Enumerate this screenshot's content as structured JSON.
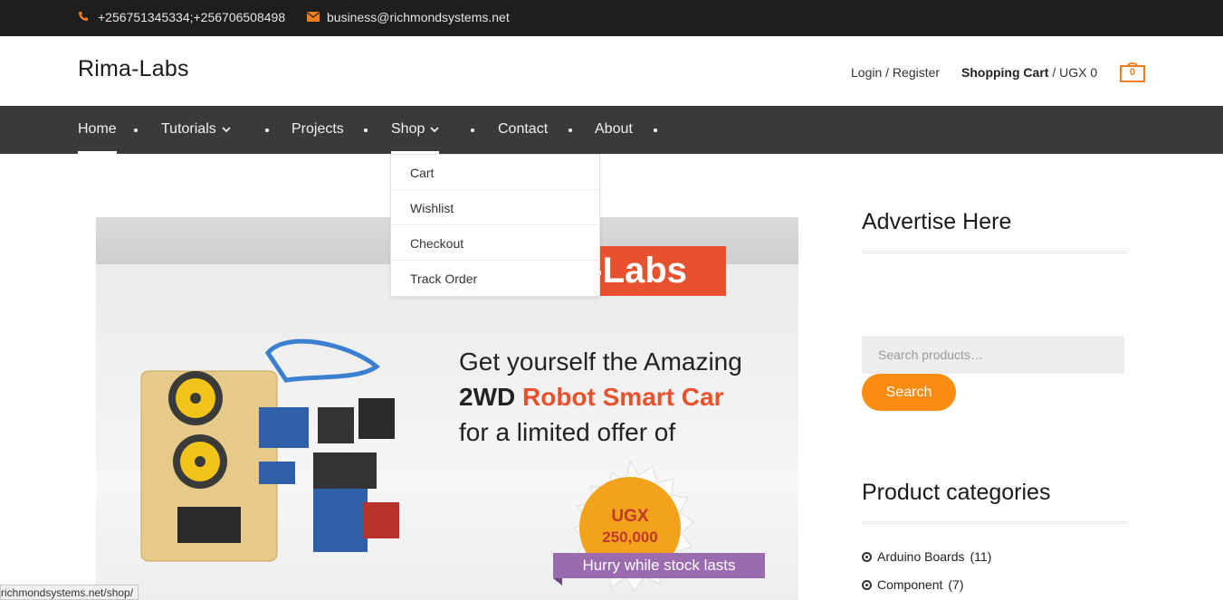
{
  "topbar": {
    "phone": "+256751345334;+256706508498",
    "email": "business@richmondsystems.net",
    "phone_icon": "phone-icon",
    "email_icon": "envelope-icon"
  },
  "header": {
    "logo": "Rima-Labs",
    "login": "Login / Register",
    "cart_label": "Shopping Cart",
    "cart_amount": " / UGX 0",
    "cart_count": "0"
  },
  "nav": {
    "items": [
      {
        "label": "Home"
      },
      {
        "label": "Tutorials"
      },
      {
        "label": "Projects"
      },
      {
        "label": "Shop"
      },
      {
        "label": "Contact"
      },
      {
        "label": "About"
      }
    ]
  },
  "shop_dropdown": {
    "items": [
      "Cart",
      "Wishlist",
      "Checkout",
      "Track Order"
    ]
  },
  "banner": {
    "brand": "a-Labs",
    "line1": "Get yourself the Amazing",
    "line2_bold": "2WD ",
    "line2_orange": "Robot Smart Car",
    "line3": "for a limited offer of",
    "price_currency": "UGX",
    "price_amount": "250,000",
    "ribbon": "Hurry while stock lasts"
  },
  "sidebar": {
    "advertise_title": "Advertise Here",
    "search_placeholder": "Search products…",
    "search_button": "Search",
    "categories_title": "Product categories",
    "categories": [
      {
        "name": "Arduino Boards",
        "count": "(11)"
      },
      {
        "name": "Component",
        "count": "(7)"
      }
    ]
  },
  "status_bar": {
    "url": "richmondsystems.net/shop/"
  },
  "colors": {
    "accent": "#f47e1f",
    "search_button": "#fb8c12",
    "nav_bg": "#3a3a3a",
    "topbar_bg": "#1e1e1e"
  }
}
